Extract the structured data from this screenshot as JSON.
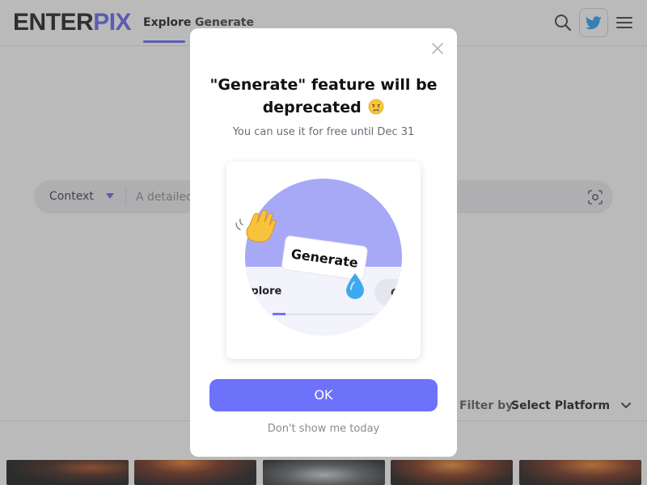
{
  "header": {
    "logo_part1": "ENTER",
    "logo_part2": "PIX",
    "tabs": [
      {
        "label": "Explore",
        "active": true
      },
      {
        "label": "Generate",
        "active": false
      }
    ],
    "icons": [
      "search-icon",
      "twitter-icon",
      "menu-icon"
    ]
  },
  "search": {
    "context_label": "Context",
    "placeholder": "A detailed"
  },
  "filter": {
    "label": "Filter by",
    "value": "Select Platform"
  },
  "modal": {
    "title": "\"Generate\" feature will be deprecated",
    "title_emoji": "crying-face",
    "subtitle": "You can use it for free until Dec 31",
    "illustration": {
      "button_label": "Generate",
      "tab_label": "xplore",
      "emojis": [
        "waving-hand",
        "droplet"
      ]
    },
    "ok_label": "OK",
    "dismiss_label": "Don't show me today"
  },
  "colors": {
    "accent": "#5b5ef0",
    "ok_button": "#6d72fb",
    "illus_circle": "#a7a9f7",
    "overlay": "rgba(90,90,90,0.42)"
  }
}
